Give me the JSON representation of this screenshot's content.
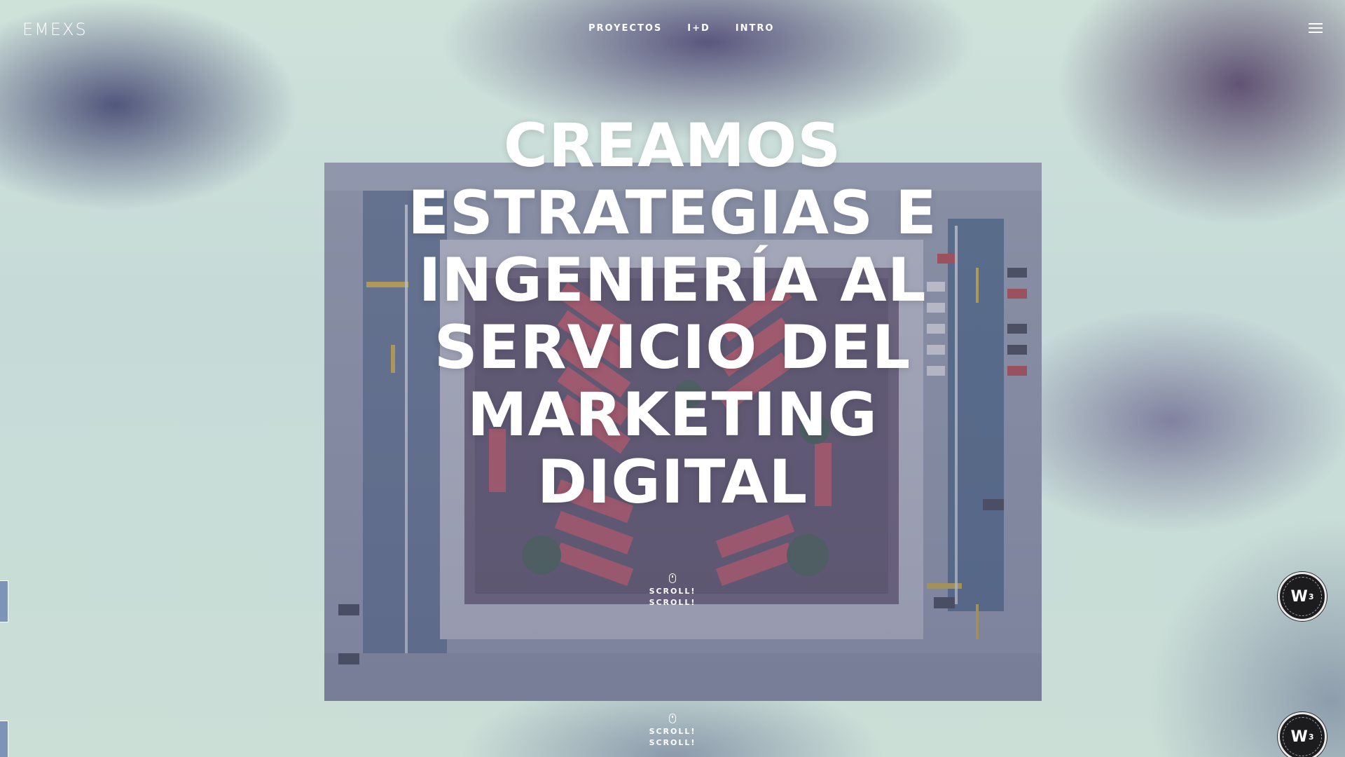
{
  "header": {
    "logo_text": "EMEXS",
    "nav": [
      {
        "label": "PROYECTOS"
      },
      {
        "label": "I+D"
      },
      {
        "label": "INTRO"
      }
    ],
    "menu_icon": "hamburger-icon"
  },
  "hero": {
    "headline_lines": [
      "CREAMOS",
      "ESTRATEGIAS E",
      "INGENIERÍA AL",
      "SERVICIO DEL",
      "MARKETING",
      "DIGITAL"
    ],
    "image_icon": "aerial-parking-lot-image"
  },
  "scroll_indicators": [
    {
      "line1": "SCROLL!",
      "line2": "SCROLL!",
      "icon": "mouse-icon"
    },
    {
      "line1": "SCROLL!",
      "line2": "SCROLL!",
      "icon": "mouse-icon"
    }
  ],
  "badges": [
    {
      "label": "W",
      "sup": "3",
      "icon": "w3-award-badge-icon"
    },
    {
      "label": "W",
      "sup": "3",
      "icon": "w3-award-badge-icon"
    }
  ],
  "colors": {
    "background": "#c9ddd8",
    "text": "#ffffff",
    "edge_tab": "#7e93b8"
  }
}
